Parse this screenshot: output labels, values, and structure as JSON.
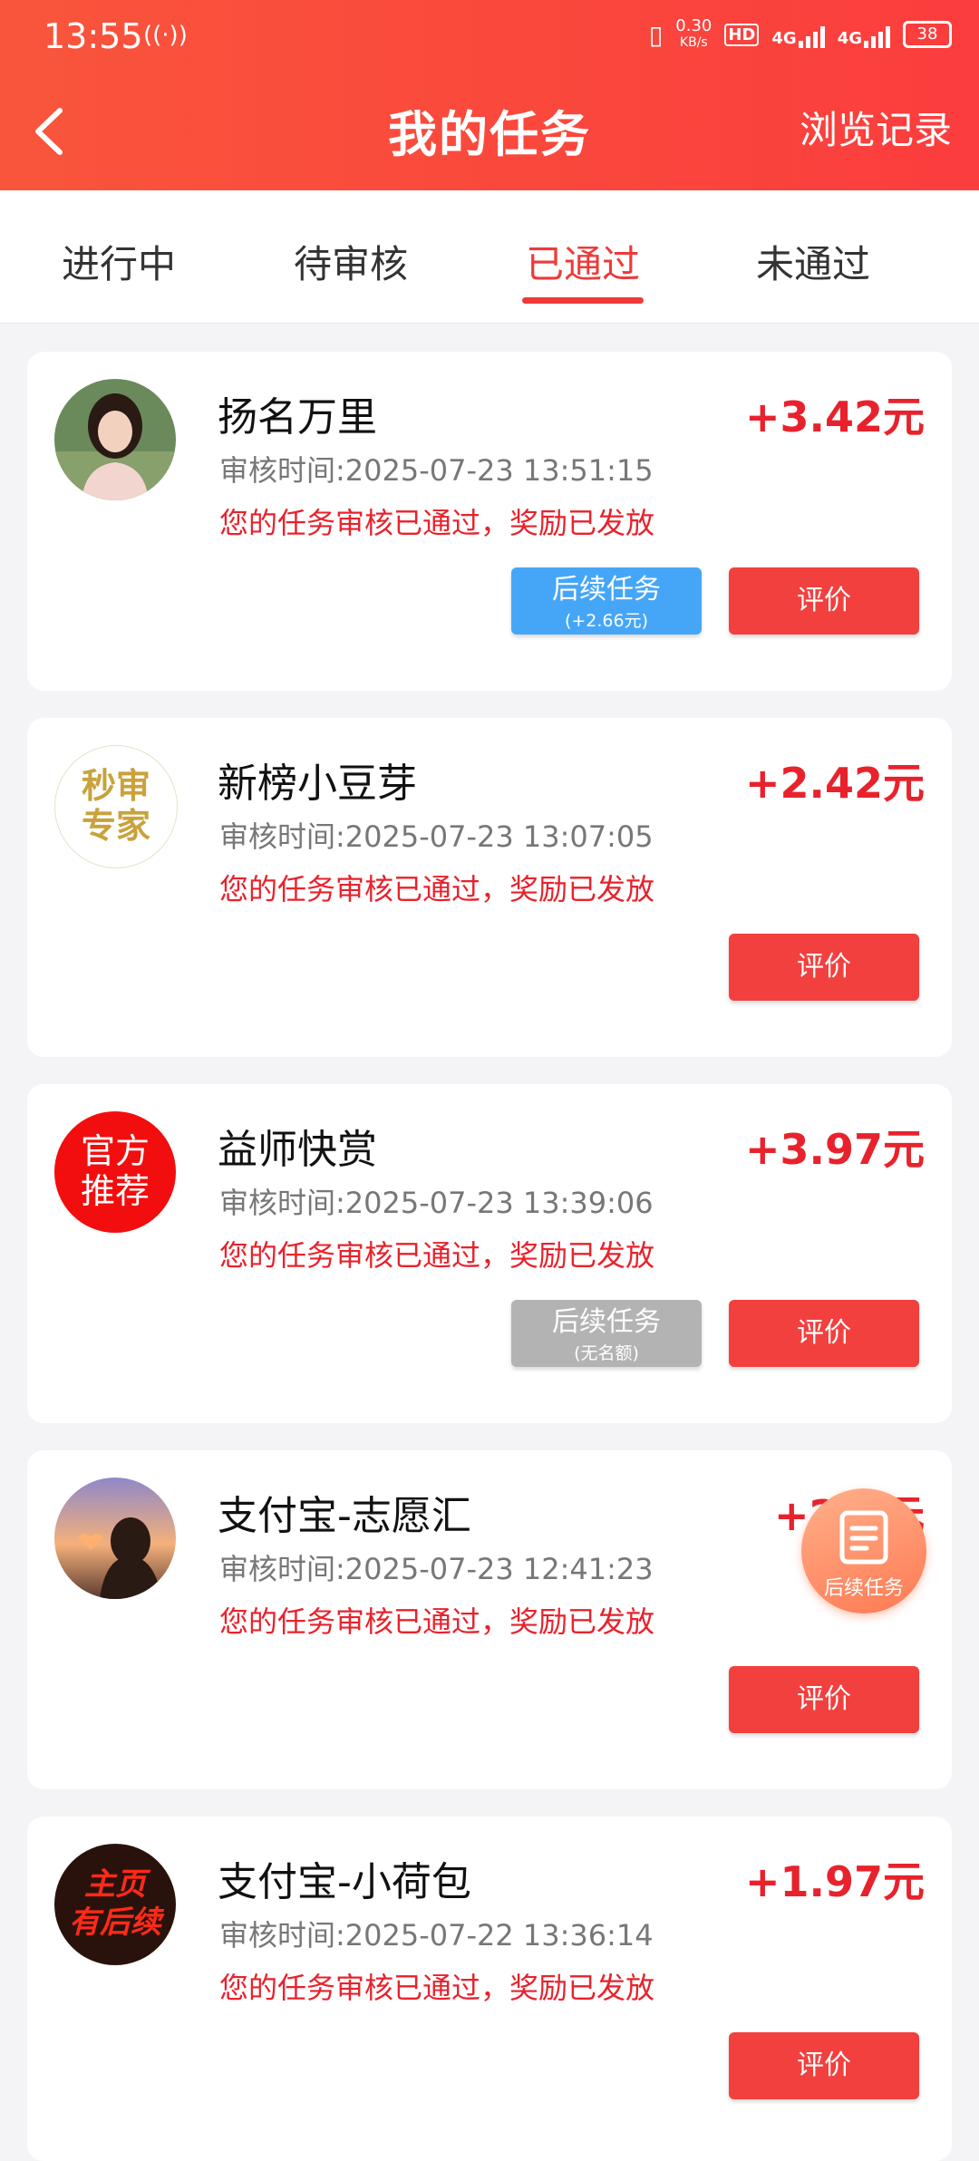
{
  "status_bar": {
    "time": "13:55",
    "net_speed": "0.30",
    "net_unit": "KB/s",
    "hd": "HD",
    "sim": "1\n2",
    "net1": "4G",
    "net2": "4G",
    "battery": "38"
  },
  "nav": {
    "title": "我的任务",
    "right_label": "浏览记录"
  },
  "tabs": [
    {
      "label": "进行中"
    },
    {
      "label": "待审核"
    },
    {
      "label": "已通过",
      "active": true
    },
    {
      "label": "未通过"
    }
  ],
  "cards": [
    {
      "name": "扬名万里",
      "amount": "+3.42元",
      "time": "审核时间:2025-07-23 13:51:15",
      "status": "您的任务审核已通过，奖励已发放",
      "follow": {
        "label": "后续任务",
        "sub": "(+2.66元)",
        "color": "#45a6f8"
      },
      "eval_label": "评价"
    },
    {
      "name": "新榜小豆芽",
      "amount": "+2.42元",
      "time": "审核时间:2025-07-23 13:07:05",
      "status": "您的任务审核已通过，奖励已发放",
      "avatar_text": "秒审\n专家",
      "eval_label": "评价"
    },
    {
      "name": "益师快赏",
      "amount": "+3.97元",
      "time": "审核时间:2025-07-23 13:39:06",
      "status": "您的任务审核已通过，奖励已发放",
      "avatar_text": "官方\n推荐",
      "follow": {
        "label": "后续任务",
        "sub": "(无名额)",
        "color": "#b3b3b3"
      },
      "eval_label": "评价"
    },
    {
      "name": "支付宝-志愿汇",
      "amount": "+2.6元",
      "time": "审核时间:2025-07-23 12:41:23",
      "status": "您的任务审核已通过，奖励已发放",
      "eval_label": "评价"
    },
    {
      "name": "支付宝-小荷包",
      "amount": "+1.97元",
      "time": "审核时间:2025-07-22 13:36:14",
      "status": "您的任务审核已通过，奖励已发放",
      "avatar_text": "主页\n有后续",
      "eval_label": "评价"
    }
  ],
  "fab": {
    "label": "后续任务",
    "icon": "document-list-icon"
  },
  "colors": {
    "header": "#fb3d3d",
    "accent": "#ee3a3a",
    "price": "#e8222c"
  }
}
